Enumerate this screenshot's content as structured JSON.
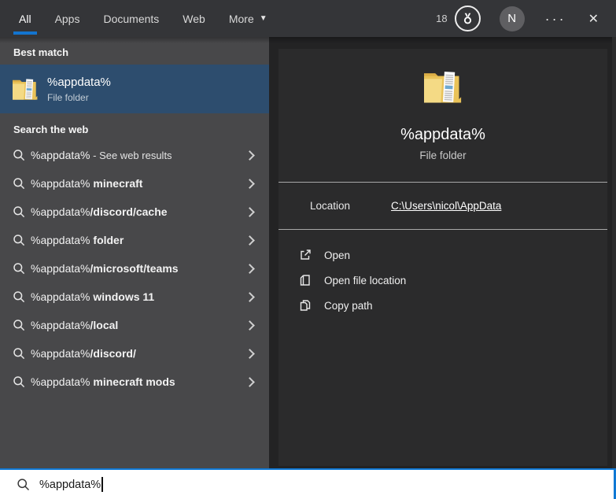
{
  "topbar": {
    "tabs": [
      {
        "label": "All",
        "active": true
      },
      {
        "label": "Apps",
        "active": false
      },
      {
        "label": "Documents",
        "active": false
      },
      {
        "label": "Web",
        "active": false
      },
      {
        "label": "More",
        "active": false,
        "has_caret": true
      }
    ],
    "rewards_count": "18",
    "avatar_initial": "N"
  },
  "icons": {
    "more_caret": "▼",
    "ellipsis": "···",
    "close": "✕"
  },
  "left_panel": {
    "best_match_header": "Best match",
    "best_match": {
      "title": "%appdata%",
      "subtitle": "File folder"
    },
    "web_header": "Search the web",
    "suggestions": [
      {
        "query": "%appdata%",
        "completion": " - See web results",
        "emphasis": "plain"
      },
      {
        "query": "%appdata%",
        "completion": " minecraft",
        "emphasis": "bold"
      },
      {
        "query": "%appdata%",
        "completion": "/discord/cache",
        "emphasis": "bold"
      },
      {
        "query": "%appdata%",
        "completion": " folder",
        "emphasis": "bold"
      },
      {
        "query": "%appdata%",
        "completion": "/microsoft/teams",
        "emphasis": "bold"
      },
      {
        "query": "%appdata%",
        "completion": " windows 11",
        "emphasis": "bold"
      },
      {
        "query": "%appdata%",
        "completion": "/local",
        "emphasis": "bold"
      },
      {
        "query": "%appdata%",
        "completion": "/discord/",
        "emphasis": "bold"
      },
      {
        "query": "%appdata%",
        "completion": " minecraft mods",
        "emphasis": "bold"
      }
    ]
  },
  "preview_panel": {
    "title": "%appdata%",
    "subtitle": "File folder",
    "location_label": "Location",
    "location_value": "C:\\Users\\nicol\\AppData",
    "actions": [
      {
        "label": "Open",
        "icon": "open-icon"
      },
      {
        "label": "Open file location",
        "icon": "open-file-location-icon"
      },
      {
        "label": "Copy path",
        "icon": "copy-path-icon"
      }
    ]
  },
  "search_box": {
    "value": "%appdata%"
  },
  "colors": {
    "accent_blue": "#0f78d4",
    "best_match_highlight": "#2d4d6e",
    "folder_yellow": "#e9c258",
    "panel_left": "#48484a",
    "panel_right": "#232324"
  }
}
